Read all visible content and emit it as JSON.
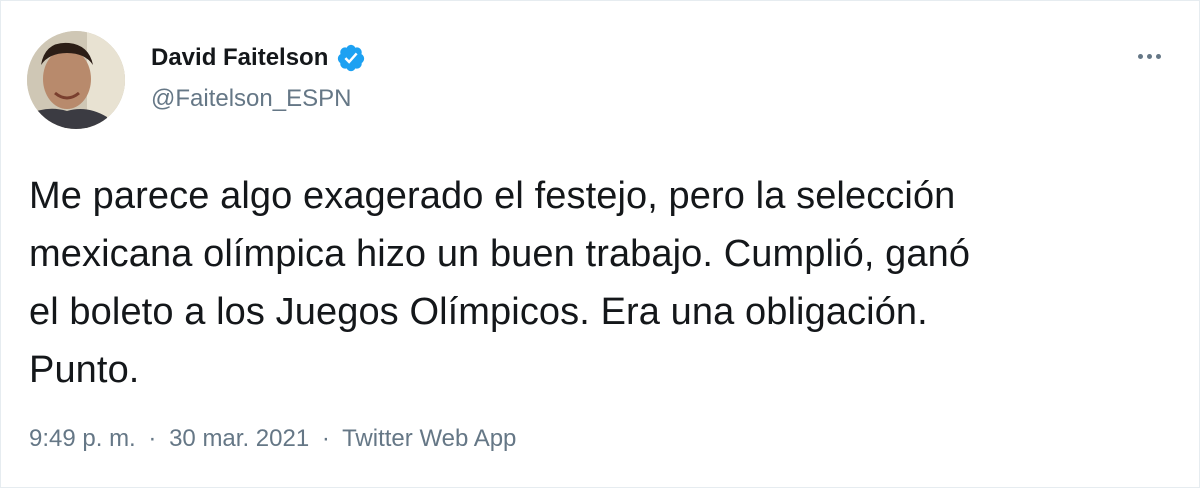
{
  "tweet": {
    "author": {
      "display_name": "David Faitelson",
      "handle": "@Faitelson_ESPN",
      "verified": true
    },
    "text_lines": [
      "Me parece algo exagerado el festejo, pero la selección",
      "mexicana olímpica hizo un buen trabajo. Cumplió, ganó",
      "el boleto a los Juegos Olímpicos. Era una obligación.",
      "Punto."
    ],
    "meta": {
      "time": "9:49 p. m.",
      "separator": "·",
      "date": "30 mar. 2021",
      "source": "Twitter Web App"
    },
    "icons": {
      "verified": "verified-badge-icon",
      "more": "more-options-icon"
    },
    "colors": {
      "verified": "#1da1f2",
      "text": "#14171a",
      "secondary": "#657786"
    }
  }
}
